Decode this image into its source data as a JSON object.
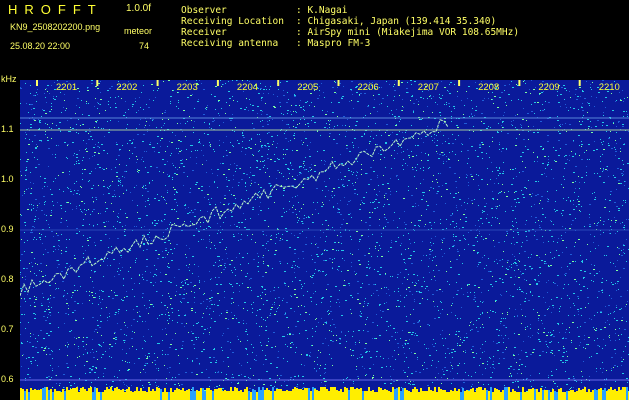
{
  "header": {
    "app_name": "HROFFT",
    "gain": "1.0.0f",
    "filename": "KN9_2508202200.png",
    "meteor_label": "meteor",
    "timestamp": "25.08.20 22:00",
    "meteor_count": "74"
  },
  "info": [
    {
      "key": "Observer",
      "value": ": K.Nagai"
    },
    {
      "key": "Receiving Location",
      "value": ": Chigasaki, Japan (139.414 35.340)"
    },
    {
      "key": "Receiver",
      "value": ": AirSpy mini (Miakejima VOR 108.65MHz)"
    },
    {
      "key": "Receiving antenna",
      "value": ": Maspro FM-3"
    }
  ],
  "axes": {
    "unit": "kHz",
    "y_ticks": [
      "1.1",
      "1.0",
      "0.9",
      "0.8",
      "0.7",
      "0.6"
    ],
    "x_ticks": [
      "2201",
      "2202",
      "2203",
      "2204",
      "2205",
      "2206",
      "2207",
      "2208",
      "2209",
      "2210"
    ]
  },
  "colors": {
    "text": "#ffff66",
    "waterfall_bg": "#0a1a9a",
    "noise_cyan": "#22c8e8",
    "trace": "#b8f8c8",
    "baseline": "#ffee00"
  }
}
